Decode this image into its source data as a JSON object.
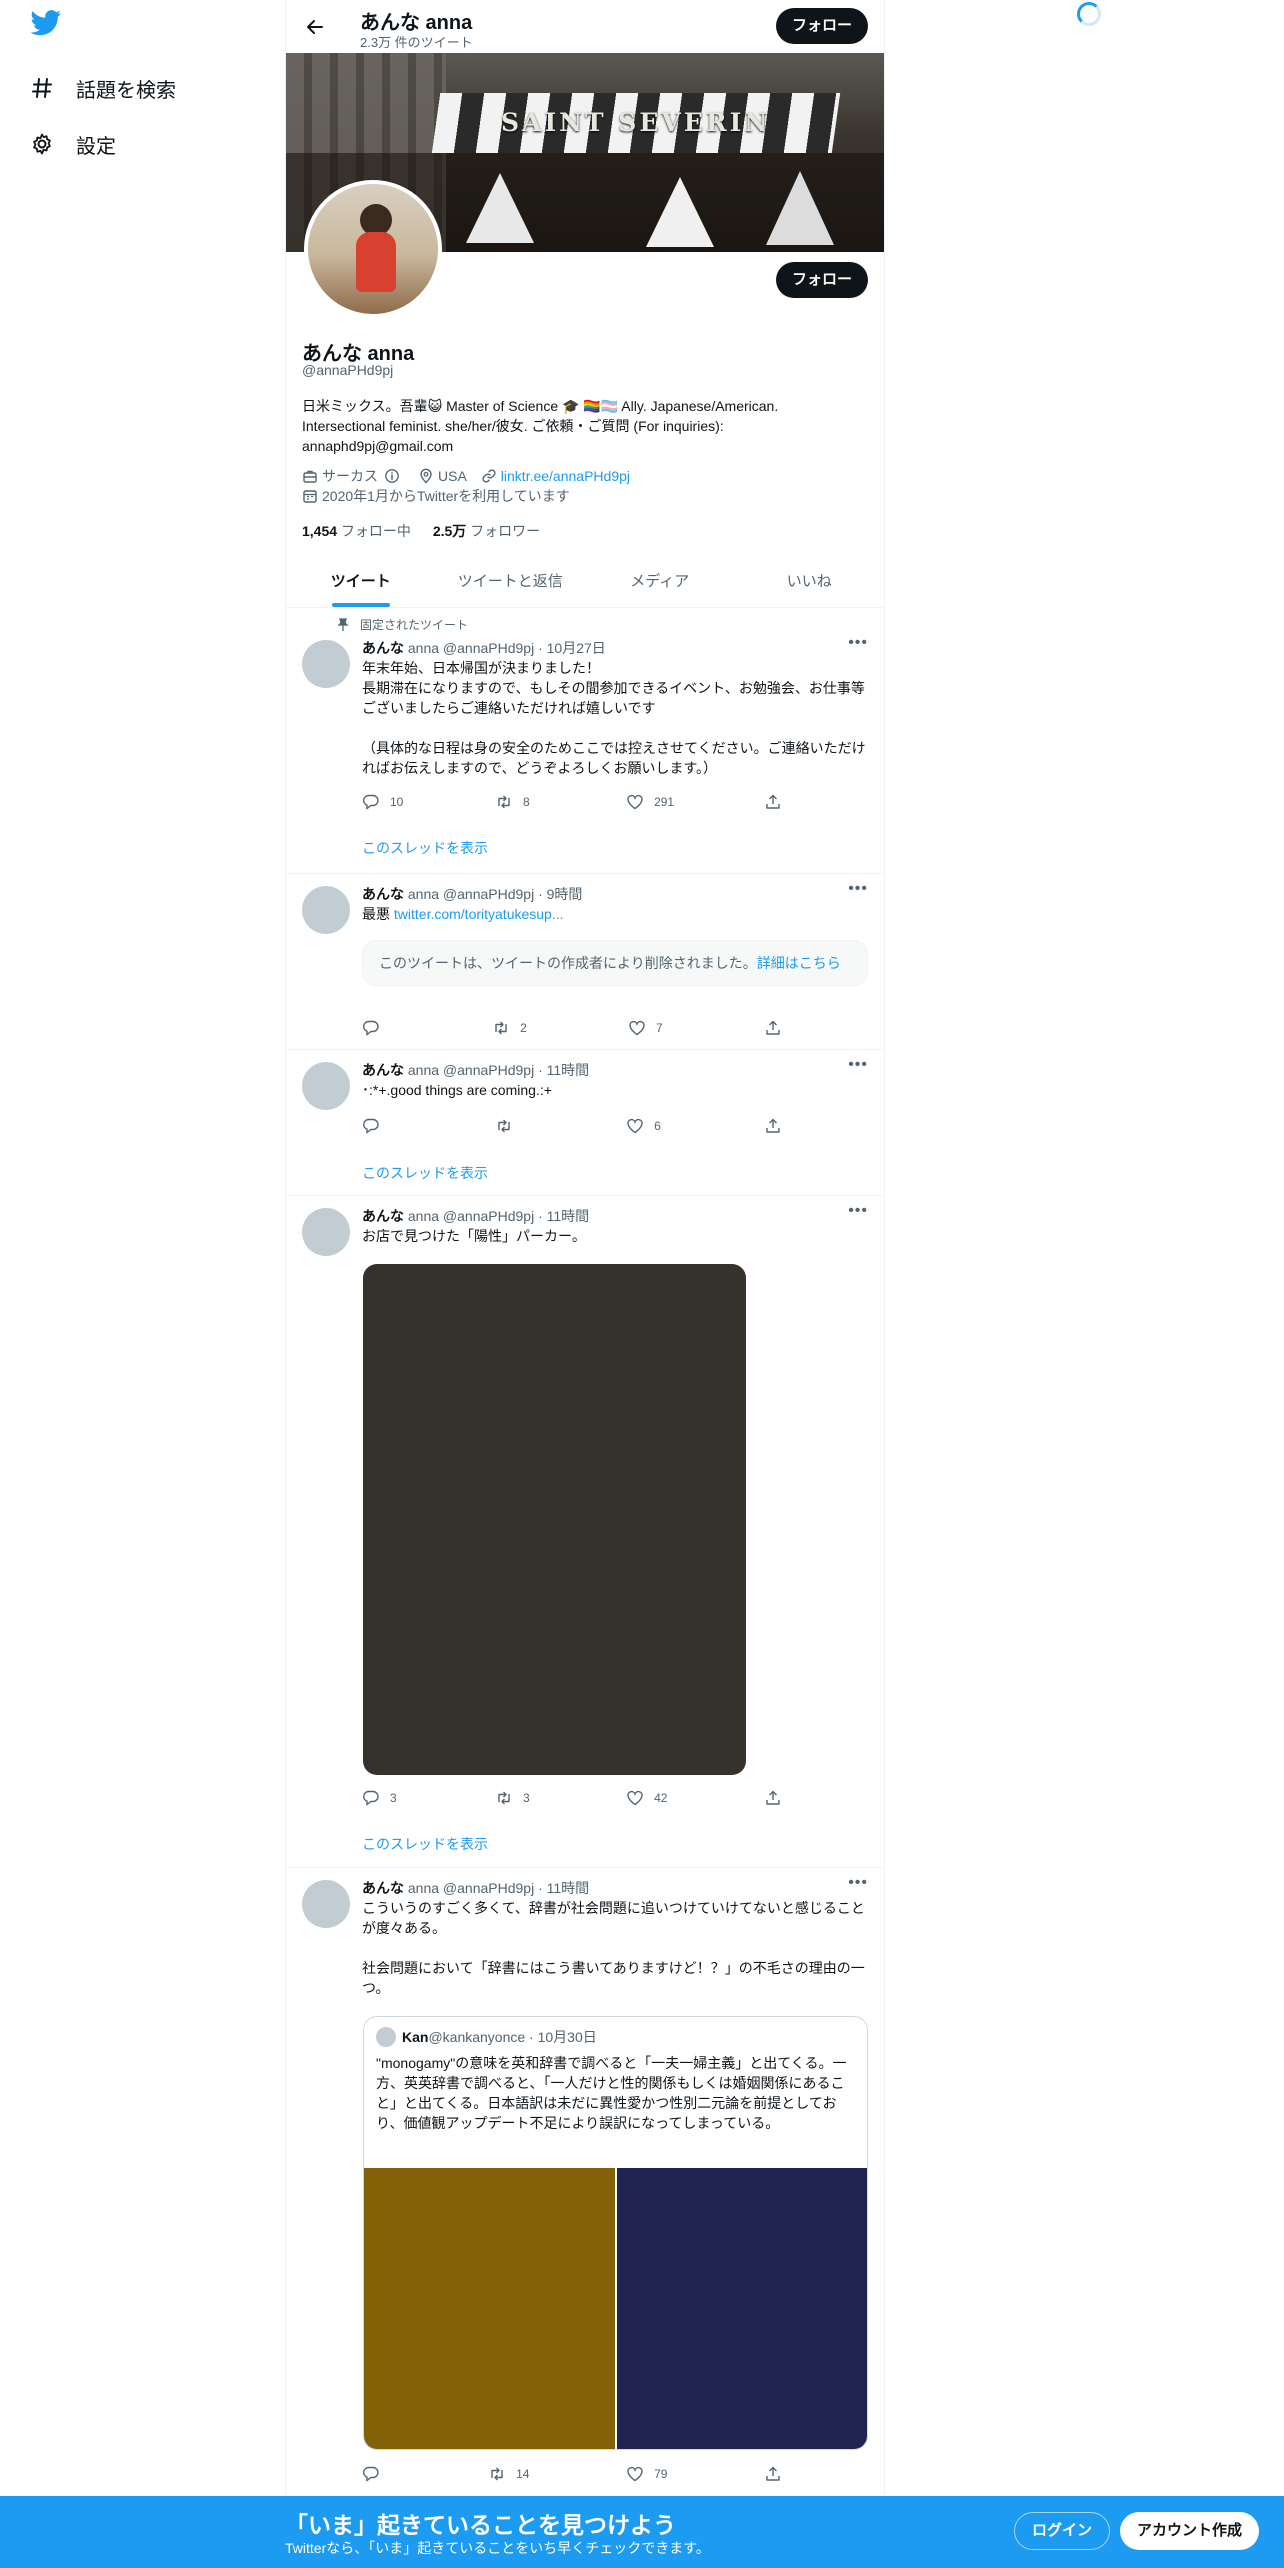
{
  "nav": {
    "items": [
      {
        "label": "話題を検索",
        "icon": "hashtag-icon"
      },
      {
        "label": "設定",
        "icon": "gear-icon"
      }
    ]
  },
  "header": {
    "name": "あんな anna",
    "tweet_count": "2.3万 件のツイート",
    "follow_label": "フォロー"
  },
  "banner": {
    "sign_text": "SAINT SEVERIN"
  },
  "profile": {
    "name": "あんな anna",
    "handle": "@annaPHd9pj",
    "follow_label": "フォロー",
    "bio_line1": "日米ミックス。吾輩😺 Master of Science 🎓 🏳️‍🌈🏳️‍⚧️ Ally. Japanese/American.",
    "bio_line2": "Intersectional feminist. she/her/彼女. ご依頼・ご質問 (For inquiries):",
    "bio_line3": "annaphd9pj@gmail.com",
    "work": "サーカス",
    "location": "USA",
    "link": "linktr.ee/annaPHd9pj",
    "joined": "2020年1月からTwitterを利用しています",
    "following_count": "1,454",
    "following_label": "フォロー中",
    "followers_count": "2.5万",
    "followers_label": "フォロワー"
  },
  "tabs": [
    "ツイート",
    "ツイートと返信",
    "メディア",
    "いいね"
  ],
  "tweets": [
    {
      "pinned_label": "固定されたツイート",
      "name": "あんな",
      "meta": " anna @annaPHd9pj · 10月27日",
      "text": "年末年始、日本帰国が決まりました！\n長期滞在になりますので、もしその間参加できるイベント、お勉強会、お仕事等ございましたらご連絡いただければ嬉しいです\n\n（具体的な日程は身の安全のためここでは控えさせてください。ご連絡いただければお伝えしますので、どうぞよろしくお願いします。）",
      "replies": "10",
      "retweets": "8",
      "likes": "291",
      "thread_label": "このスレッドを表示"
    },
    {
      "name": "あんな",
      "meta": " anna @annaPHd9pj · 9時間",
      "text_prefix": "最悪 ",
      "link": "twitter.com/torityatukesup...",
      "deleted_text": "このツイートは、ツイートの作成者により削除されました。",
      "deleted_link": "詳細はこちら",
      "replies": "",
      "retweets": "2",
      "likes": "7"
    },
    {
      "name": "あんな",
      "meta": " anna @annaPHd9pj · 11時間",
      "text": "･:*+.good things are coming.:+",
      "replies": "",
      "retweets": "",
      "likes": "6",
      "thread_label": "このスレッドを表示"
    },
    {
      "name": "あんな",
      "meta": " anna @annaPHd9pj · 11時間",
      "text": "お店で見つけた「陽性」パーカー。",
      "replies": "3",
      "retweets": "3",
      "likes": "42",
      "thread_label": "このスレッドを表示"
    },
    {
      "name": "あんな",
      "meta": " anna @annaPHd9pj · 11時間",
      "text": "こういうのすごく多くて、辞書が社会問題に追いつけていけてないと感じることが度々ある。\n\n社会問題において「辞書にはこう書いてありますけど！？」の不毛さの理由の一つ。",
      "quote": {
        "name": "Kan",
        "meta": " @kankanyonce · 10月30日",
        "text": "\"monogamy\"の意味を英和辞書で調べると「一夫一婦主義」と出てくる。一方、英英辞書で調べると、「一人だけと性的関係もしくは婚姻関係にあること」と出てくる。日本語訳は未だに異性愛かつ性別二元論を前提としており、価値観アップデート不足により誤訳になってしまっている。"
      },
      "replies": "",
      "retweets": "14",
      "likes": "79"
    }
  ],
  "bottom": {
    "title": "「いま」起きていることを見つけよう",
    "subtitle": "Twitterなら、「いま」起きていることをいち早くチェックできます。",
    "login": "ログイン",
    "signup": "アカウント作成"
  },
  "colors": {
    "accent": "#1d9bf0",
    "text": "#0f1419",
    "muted": "#536471"
  }
}
